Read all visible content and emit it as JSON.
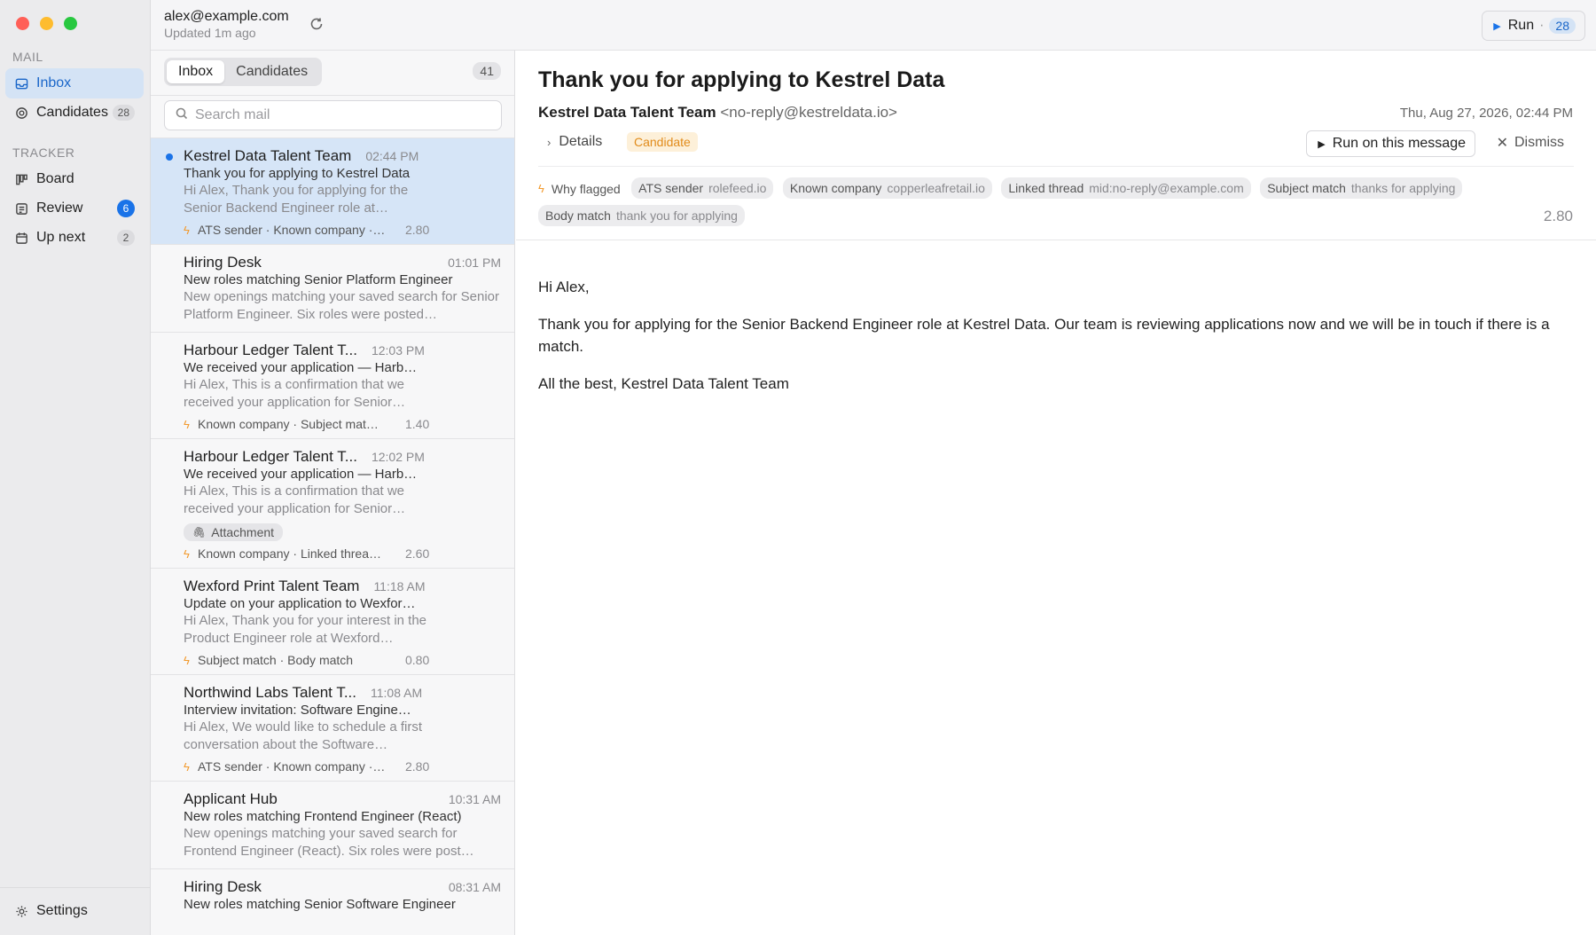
{
  "account": {
    "email": "alex@example.com",
    "updated": "Updated 1m ago"
  },
  "run_button": {
    "label": "Run",
    "count": "28"
  },
  "sidebar": {
    "mail_header": "MAIL",
    "tracker_header": "TRACKER",
    "mail_items": [
      {
        "label": "Inbox",
        "icon": "inbox-icon"
      },
      {
        "label": "Candidates",
        "count": "28",
        "icon": "target-icon"
      }
    ],
    "tracker_items": [
      {
        "label": "Board",
        "icon": "board-icon"
      },
      {
        "label": "Review",
        "count": "6",
        "icon": "review-icon"
      },
      {
        "label": "Up next",
        "count": "2",
        "icon": "calendar-icon"
      }
    ],
    "settings_label": "Settings"
  },
  "list": {
    "tabs": [
      "Inbox",
      "Candidates"
    ],
    "count": "41",
    "search_placeholder": "Search mail",
    "messages": [
      {
        "sender": "Kestrel Data Talent Team",
        "time": "02:44 PM",
        "subject": "Thank you for applying to Kestrel Data",
        "preview": "Hi Alex, Thank you for applying for the Senior Backend Engineer role at…",
        "tags": "ATS sender · Known company ·…",
        "score": "2.80",
        "unread": true,
        "selected": true
      },
      {
        "sender": "Hiring Desk",
        "time": "01:01 PM",
        "subject": "New roles matching Senior Platform Engineer",
        "preview": "New openings matching your saved search for Senior Platform Engineer. Six roles were posted…"
      },
      {
        "sender": "Harbour Ledger Talent T...",
        "time": "12:03 PM",
        "subject": "We received your application — Harb…",
        "preview": "Hi Alex, This is a confirmation that we received your application for Senior…",
        "tags": "Known company · Subject mat…",
        "score": "1.40"
      },
      {
        "sender": "Harbour Ledger Talent T...",
        "time": "12:02 PM",
        "subject": "We received your application — Harb…",
        "preview": "Hi Alex, This is a confirmation that we received your application for Senior…",
        "attachment": "Attachment",
        "tags": "Known company · Linked threa…",
        "score": "2.60"
      },
      {
        "sender": "Wexford Print Talent Team",
        "time": "11:18 AM",
        "subject": "Update on your application to Wexfor…",
        "preview": "Hi Alex, Thank you for your interest in the Product Engineer role at Wexford…",
        "tags": "Subject match · Body match",
        "score": "0.80"
      },
      {
        "sender": "Northwind Labs Talent T...",
        "time": "11:08 AM",
        "subject": "Interview invitation: Software Engine…",
        "preview": "Hi Alex, We would like to schedule a first conversation about the Software…",
        "tags": "ATS sender · Known company ·…",
        "score": "2.80"
      },
      {
        "sender": "Applicant Hub",
        "time": "10:31 AM",
        "subject": "New roles matching Frontend Engineer (React)",
        "preview": "New openings matching your saved search for Frontend Engineer (React). Six roles were post…"
      },
      {
        "sender": "Hiring Desk",
        "time": "08:31 AM",
        "subject": "New roles matching Senior Software Engineer",
        "preview": ""
      }
    ]
  },
  "reader": {
    "title": "Thank you for applying to Kestrel Data",
    "from_name": "Kestrel Data Talent Team",
    "from_addr": "<no-reply@kestreldata.io>",
    "date": "Thu, Aug 27, 2026, 02:44 PM",
    "details_label": "Details",
    "badge": "Candidate",
    "run_label": "Run on this message",
    "dismiss_label": "Dismiss",
    "why_label": "Why flagged",
    "flags": [
      {
        "k": "ATS sender",
        "v": "rolefeed.io"
      },
      {
        "k": "Known company",
        "v": "copperleafretail.io"
      },
      {
        "k": "Linked thread",
        "v": "mid:no-reply@example.com"
      },
      {
        "k": "Subject match",
        "v": "thanks for applying"
      },
      {
        "k": "Body match",
        "v": "thank you for applying"
      }
    ],
    "score": "2.80",
    "body": [
      "Hi Alex,",
      "Thank you for applying for the Senior Backend Engineer role at Kestrel Data. Our team is reviewing applications now and we will be in touch if there is a match.",
      "All the best, Kestrel Data Talent Team"
    ]
  },
  "colors": {
    "accent": "#1a73e8",
    "selected_row": "#d6e5f7",
    "flag": "#f29a2e",
    "candidate_bg": "#fdf0d9",
    "candidate_fg": "#e18b1a"
  }
}
